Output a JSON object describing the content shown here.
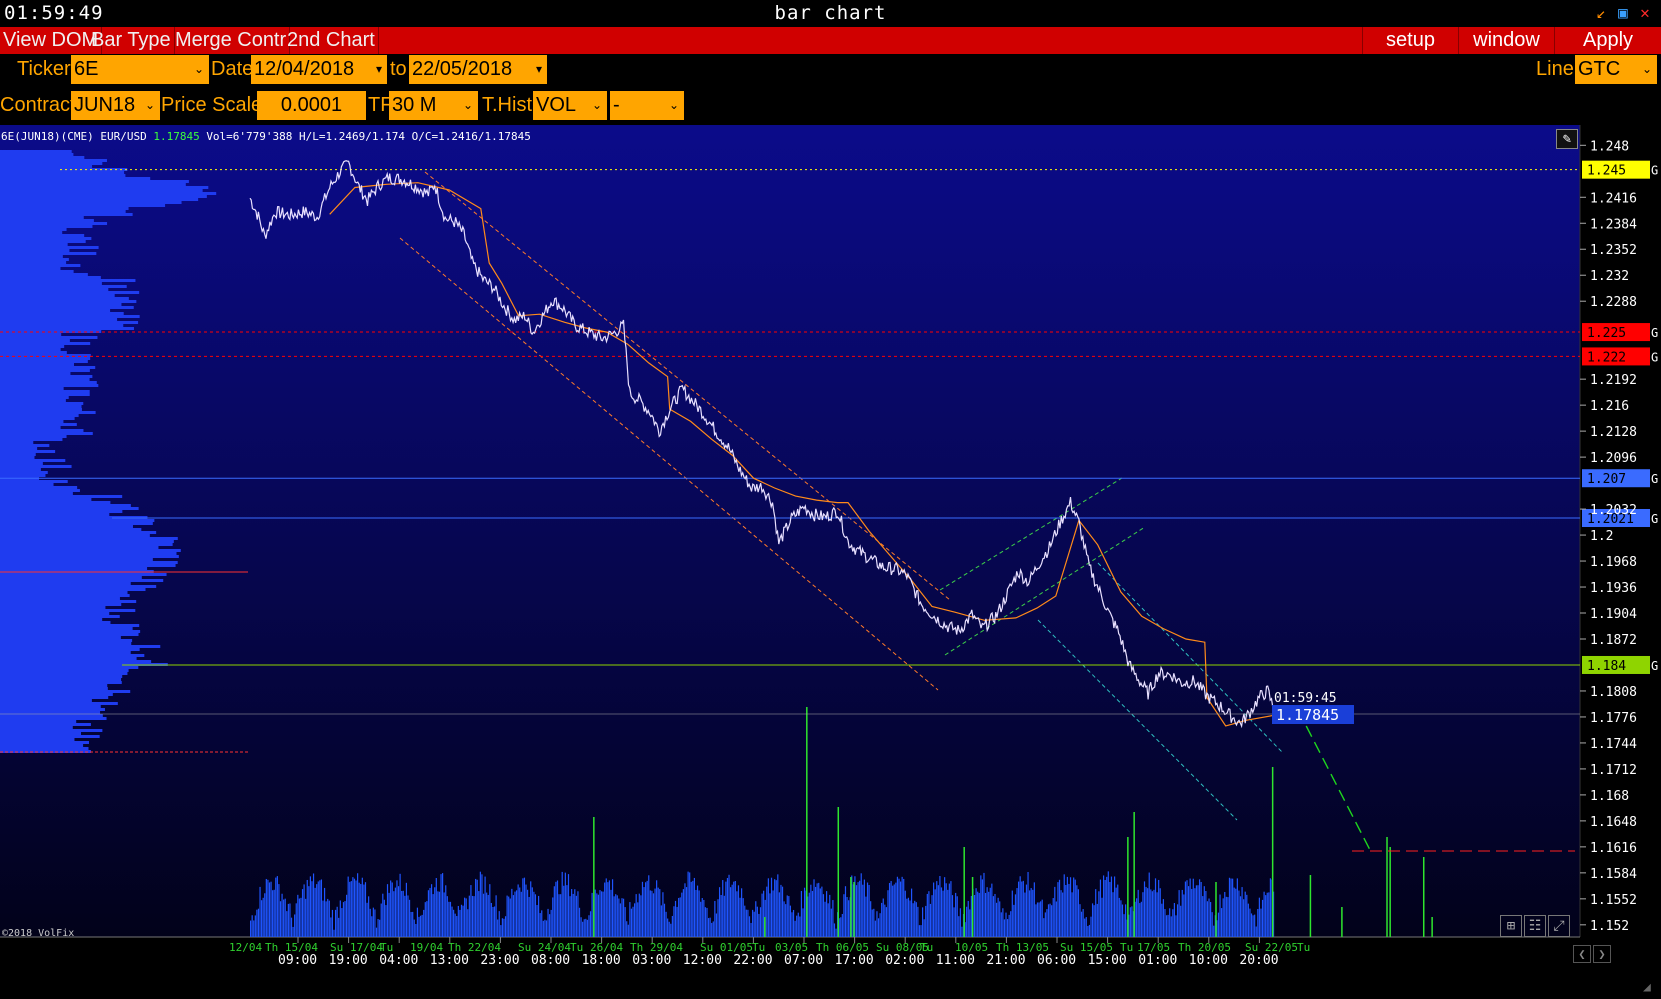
{
  "window": {
    "clock": "01:59:49",
    "title": "bar chart"
  },
  "menu": {
    "items": [
      "View DOM",
      "Bar Type",
      "Merge Contr",
      "2nd Chart"
    ],
    "setup": "setup",
    "window": "window",
    "apply": "Apply"
  },
  "toolbar": {
    "ticker_label": "Ticker",
    "ticker_value": "6E",
    "date_label": "Date",
    "date_from": "12/04/2018",
    "to_label": "to",
    "date_to": "22/05/2018",
    "line_label": "Line",
    "line_value": "GTC",
    "contract_label": "Contract",
    "contract_value": "JUN18",
    "price_scale_label": "Price Scale",
    "price_scale_value": "0.0001",
    "tf_label": "TF",
    "tf_value": "30 M",
    "thist_label": "T.Hist",
    "thist_value": "VOL",
    "extra_value": "-"
  },
  "info": {
    "instrument": "6E(JUN18)(CME) EUR/USD",
    "last": "1.17845",
    "stats": "Vol=6'779'388 H/L=1.2469/1.174 O/C=1.2416/1.17845"
  },
  "copyright": "©2018 VolFix",
  "chart_data": {
    "type": "line",
    "y_ticks": [
      "1.248",
      "1.2416",
      "1.2384",
      "1.2352",
      "1.232",
      "1.2288",
      "1.2192",
      "1.216",
      "1.2128",
      "1.2096",
      "1.2032",
      "1.2",
      "1.1968",
      "1.1936",
      "1.1904",
      "1.1872",
      "1.1808",
      "1.1776",
      "1.1744",
      "1.1712",
      "1.168",
      "1.1648",
      "1.1616",
      "1.1584",
      "1.1552",
      "1.152"
    ],
    "ylim": [
      1.1505,
      1.2505
    ],
    "x_day_labels": [
      "12/04",
      "Th 15/04",
      "Su 17/04",
      "Tu",
      "19/04",
      "Th 22/04",
      "Su 24/04",
      "Tu",
      "26/04",
      "Th 29/04",
      "Su 01/05",
      "Tu",
      "03/05",
      "Th 06/05",
      "Su 08/05",
      "Tu",
      "10/05",
      "Th 13/05",
      "Su 15/05",
      "Tu",
      "17/05",
      "Th 20/05",
      "Su 22/05",
      "Tu"
    ],
    "x_time_labels": [
      "09:00",
      "19:00",
      "04:00",
      "13:00",
      "23:00",
      "08:00",
      "18:00",
      "03:00",
      "12:00",
      "22:00",
      "07:00",
      "17:00",
      "02:00",
      "11:00",
      "21:00",
      "06:00",
      "15:00",
      "01:00",
      "10:00",
      "20:00"
    ],
    "levels": [
      {
        "value": 1.245,
        "label": "1.245",
        "color": "#ffff00",
        "style": "dotted",
        "text_color": "#000"
      },
      {
        "value": 1.225,
        "label": "1.225",
        "color": "#ff0000",
        "style": "dashed",
        "text_color": "#000"
      },
      {
        "value": 1.222,
        "label": "1.222",
        "color": "#ff0000",
        "style": "dashed",
        "text_color": "#000"
      },
      {
        "value": 1.207,
        "label": "1.207",
        "color": "#3a6bff",
        "style": "solid",
        "text_color": "#000"
      },
      {
        "value": 1.2021,
        "label": "1.2021",
        "color": "#3a6bff",
        "style": "solid",
        "text_color": "#000"
      },
      {
        "value": 1.184,
        "label": "1.184",
        "color": "#8fd400",
        "style": "solid",
        "text_color": "#000"
      }
    ],
    "level_tag": "G",
    "current_price": {
      "value": 1.17845,
      "label": "1.17845",
      "time": "01:59:45"
    },
    "price_path": [
      [
        0,
        1.2415
      ],
      [
        8,
        1.2392
      ],
      [
        14,
        1.2368
      ],
      [
        24,
        1.2398
      ],
      [
        38,
        1.2394
      ],
      [
        52,
        1.2398
      ],
      [
        64,
        1.2392
      ],
      [
        76,
        1.2428
      ],
      [
        86,
        1.2448
      ],
      [
        94,
        1.2458
      ],
      [
        104,
        1.2428
      ],
      [
        112,
        1.2412
      ],
      [
        122,
        1.243
      ],
      [
        132,
        1.244
      ],
      [
        146,
        1.2438
      ],
      [
        160,
        1.2428
      ],
      [
        170,
        1.242
      ],
      [
        176,
        1.2432
      ],
      [
        186,
        1.239
      ],
      [
        196,
        1.2385
      ],
      [
        204,
        1.237
      ],
      [
        212,
        1.2335
      ],
      [
        222,
        1.2315
      ],
      [
        232,
        1.2305
      ],
      [
        242,
        1.2282
      ],
      [
        252,
        1.2265
      ],
      [
        262,
        1.227
      ],
      [
        270,
        1.225
      ],
      [
        280,
        1.2272
      ],
      [
        288,
        1.229
      ],
      [
        298,
        1.228
      ],
      [
        310,
        1.2258
      ],
      [
        322,
        1.225
      ],
      [
        336,
        1.2242
      ],
      [
        346,
        1.2248
      ],
      [
        356,
        1.2258
      ],
      [
        362,
        1.2175
      ],
      [
        372,
        1.2165
      ],
      [
        382,
        1.215
      ],
      [
        390,
        1.2128
      ],
      [
        400,
        1.2155
      ],
      [
        412,
        1.218
      ],
      [
        422,
        1.2165
      ],
      [
        432,
        1.215
      ],
      [
        444,
        1.2128
      ],
      [
        456,
        1.2108
      ],
      [
        466,
        1.2082
      ],
      [
        478,
        1.2058
      ],
      [
        488,
        1.206
      ],
      [
        498,
        1.204
      ],
      [
        504,
        1.199
      ],
      [
        516,
        1.202
      ],
      [
        528,
        1.2035
      ],
      [
        538,
        1.2025
      ],
      [
        548,
        1.2022
      ],
      [
        560,
        1.203
      ],
      [
        570,
        1.1992
      ],
      [
        578,
        1.1982
      ],
      [
        592,
        1.197
      ],
      [
        604,
        1.196
      ],
      [
        616,
        1.1958
      ],
      [
        626,
        1.195
      ],
      [
        640,
        1.1915
      ],
      [
        652,
        1.19
      ],
      [
        664,
        1.1888
      ],
      [
        676,
        1.1882
      ],
      [
        688,
        1.1902
      ],
      [
        698,
        1.1885
      ],
      [
        712,
        1.1902
      ],
      [
        722,
        1.1928
      ],
      [
        732,
        1.1955
      ],
      [
        742,
        1.1942
      ],
      [
        752,
        1.1965
      ],
      [
        762,
        1.1985
      ],
      [
        772,
        1.2015
      ],
      [
        782,
        1.204
      ],
      [
        790,
        1.2015
      ],
      [
        800,
        1.196
      ],
      [
        810,
        1.193
      ],
      [
        820,
        1.19
      ],
      [
        828,
        1.188
      ],
      [
        838,
        1.184
      ],
      [
        848,
        1.182
      ],
      [
        856,
        1.1805
      ],
      [
        866,
        1.183
      ],
      [
        878,
        1.1828
      ],
      [
        888,
        1.1818
      ],
      [
        900,
        1.182
      ],
      [
        912,
        1.1802
      ],
      [
        924,
        1.179
      ],
      [
        934,
        1.1778
      ],
      [
        944,
        1.1768
      ],
      [
        952,
        1.178
      ],
      [
        962,
        1.18
      ],
      [
        970,
        1.1808
      ],
      [
        976,
        1.17845
      ]
    ],
    "ma_path": [
      [
        76,
        1.2395
      ],
      [
        100,
        1.2428
      ],
      [
        130,
        1.2432
      ],
      [
        160,
        1.2434
      ],
      [
        190,
        1.2425
      ],
      [
        220,
        1.2402
      ],
      [
        228,
        1.2335
      ],
      [
        240,
        1.231
      ],
      [
        256,
        1.227
      ],
      [
        276,
        1.2272
      ],
      [
        300,
        1.2262
      ],
      [
        320,
        1.2255
      ],
      [
        340,
        1.225
      ],
      [
        360,
        1.2235
      ],
      [
        380,
        1.2212
      ],
      [
        398,
        1.2195
      ],
      [
        400,
        1.2155
      ],
      [
        420,
        1.214
      ],
      [
        440,
        1.2118
      ],
      [
        460,
        1.2098
      ],
      [
        480,
        1.207
      ],
      [
        500,
        1.2058
      ],
      [
        520,
        1.2048
      ],
      [
        540,
        1.2043
      ],
      [
        560,
        1.204
      ],
      [
        570,
        1.204
      ],
      [
        590,
        1.2005
      ],
      [
        610,
        1.1975
      ],
      [
        630,
        1.1945
      ],
      [
        650,
        1.1912
      ],
      [
        672,
        1.1905
      ],
      [
        700,
        1.1895
      ],
      [
        730,
        1.1898
      ],
      [
        750,
        1.191
      ],
      [
        768,
        1.1925
      ],
      [
        790,
        1.2018
      ],
      [
        808,
        1.1988
      ],
      [
        830,
        1.193
      ],
      [
        850,
        1.19
      ],
      [
        870,
        1.1885
      ],
      [
        892,
        1.1872
      ],
      [
        910,
        1.1868
      ],
      [
        912,
        1.18
      ],
      [
        930,
        1.1765
      ],
      [
        950,
        1.1772
      ],
      [
        976,
        1.1778
      ]
    ]
  }
}
